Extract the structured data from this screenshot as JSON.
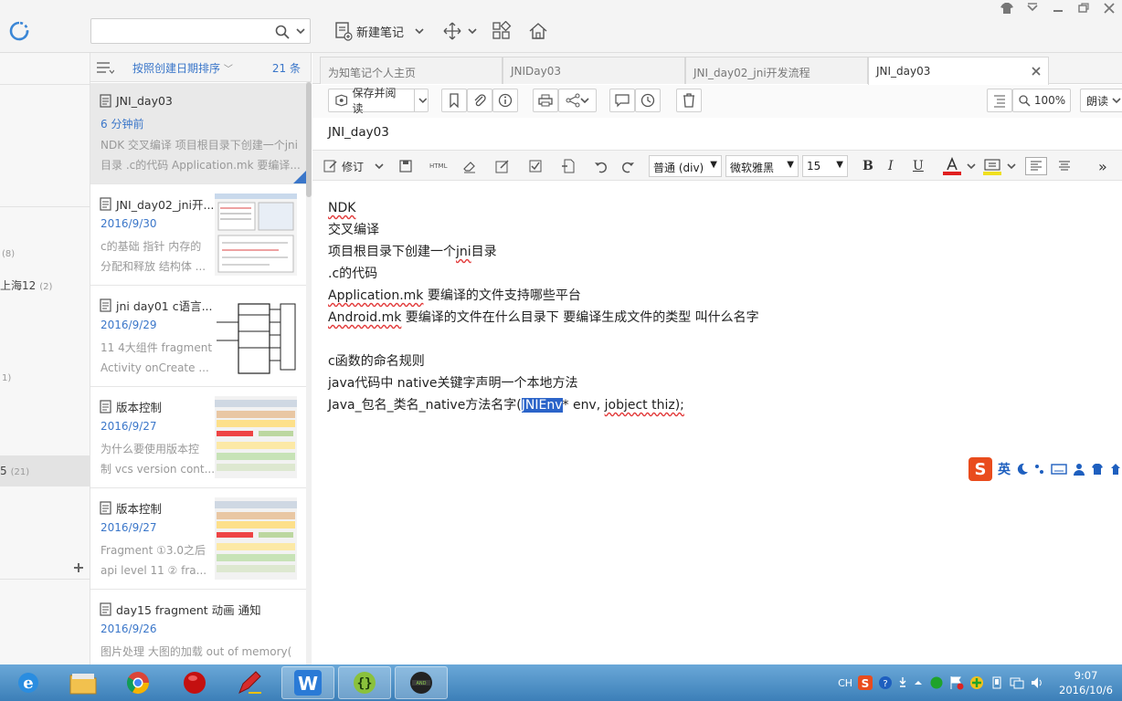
{
  "toolbar": {
    "search_value": "",
    "new_note_label": "新建笔记"
  },
  "sidebar": {
    "items": [
      {
        "label": "",
        "count": "(8)"
      },
      {
        "label": "上海12",
        "count": "(2)"
      },
      {
        "label": "",
        "count": "1)"
      },
      {
        "label": "5",
        "count": "(21)"
      }
    ]
  },
  "notelist": {
    "sort_label": "按照创建日期排序",
    "count_label": "21 条",
    "notes": [
      {
        "title": "JNI_day03",
        "date": "6 分钟前",
        "snippet1": "NDK 交叉编译 项目根目录下创建一个jni",
        "snippet2": "目录 .c的代码 Application.mk 要编译..."
      },
      {
        "title": "JNI_day02_jni开...",
        "date": "2016/9/30",
        "snippet1": "c的基础 指针 内存的",
        "snippet2": "分配和释放 结构体 ..."
      },
      {
        "title": "jni day01 c语言...",
        "date": "2016/9/29",
        "snippet1": "11 4大组件 fragment",
        "snippet2": " Activity onCreate ..."
      },
      {
        "title": "版本控制",
        "date": "2016/9/27",
        "snippet1": "为什么要使用版本控",
        "snippet2": "制 vcs version cont..."
      },
      {
        "title": "版本控制",
        "date": "2016/9/27",
        "snippet1": "Fragment ①3.0之后",
        "snippet2": "api level 11 ② fra..."
      },
      {
        "title": "day15 fragment 动画 通知",
        "date": "2016/9/26",
        "snippet1": "图片处理 大图的加载 out of memory(",
        "snippet2": ""
      }
    ]
  },
  "tabs": [
    {
      "label": "为知笔记个人主页"
    },
    {
      "label": "JNIDay03"
    },
    {
      "label": "JNI_day02_jni开发流程"
    },
    {
      "label": "JNI_day03"
    }
  ],
  "editor": {
    "save_read_label": "保存并阅读",
    "zoom_label": "100%",
    "read_aloud_label": "朗读",
    "note_title": "JNI_day03",
    "revise_label": "修订",
    "html_label": "HTML",
    "style_select": "普通 (div)",
    "font_select": "微软雅黑",
    "size_select": "15",
    "bold": "B",
    "italic": "I",
    "underline": "U",
    "more": "»",
    "content": {
      "l1": "NDK",
      "l2": "交叉编译",
      "l3a": "项目根目录下创建一个",
      "l3b": "jni",
      "l3c": "目录",
      "l4": ".c的代码",
      "l5a": "Application.mk",
      "l5b": " 要编译的文件支持哪些平台",
      "l6a": "Android.mk",
      "l6b": " 要编译的文件在什么目录下 要编译生成文件的类型 叫什么名字",
      "l7": "c函数的命名规则",
      "l8": "java代码中 native关键字声明一个本地方法",
      "l9a": "Java_包名_类名_native方法名字(",
      "l9b": "JNIEnv",
      "l9c": "* env, ",
      "l9d": "jobject thiz);"
    },
    "ime_label": "英"
  },
  "taskbar": {
    "lang": "CH",
    "time": "9:07",
    "date": "2016/10/6"
  },
  "colors": {
    "accent": "#3a76c9",
    "taskbar": "#4a90c8",
    "selection": "#2b64c9"
  }
}
